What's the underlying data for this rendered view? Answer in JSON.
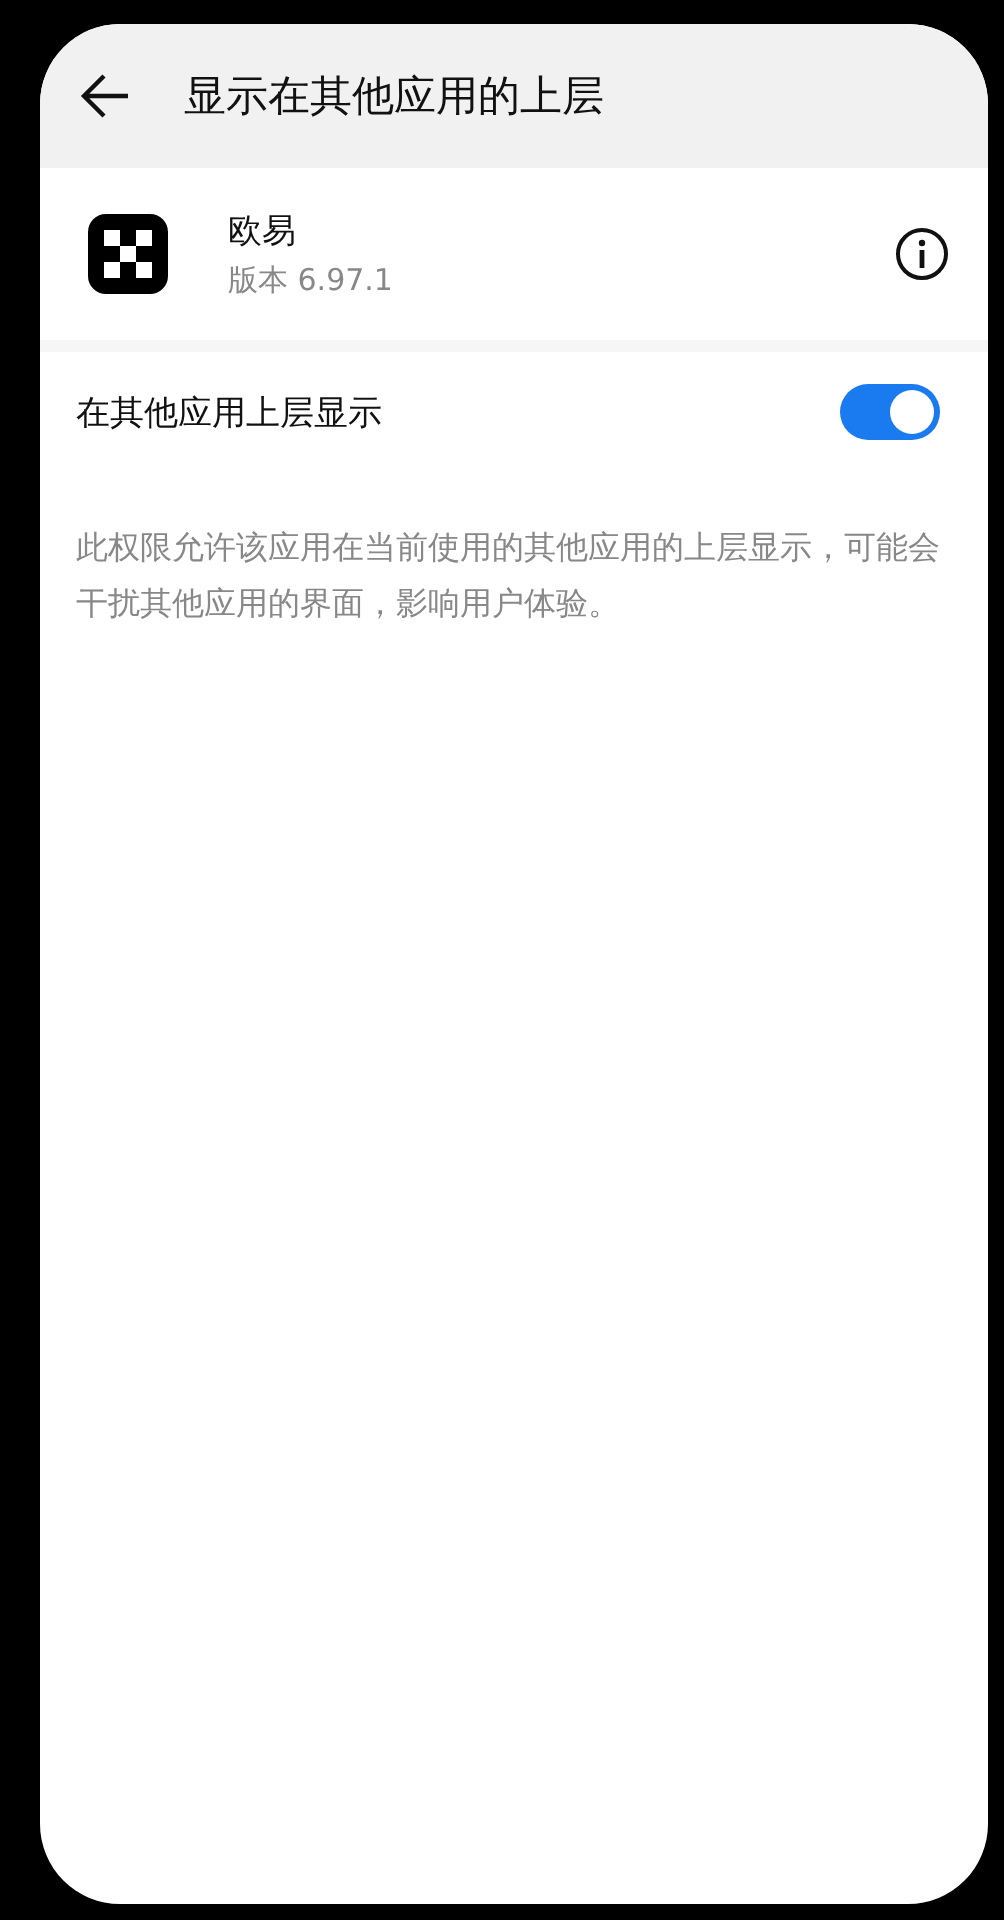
{
  "header": {
    "title": "显示在其他应用的上层"
  },
  "app": {
    "name": "欧易",
    "version": "版本 6.97.1"
  },
  "setting": {
    "label": "在其他应用上层显示",
    "on": true
  },
  "description": "此权限允许该应用在当前使用的其他应用的上层显示，可能会干扰其他应用的界面，影响用户体验。"
}
